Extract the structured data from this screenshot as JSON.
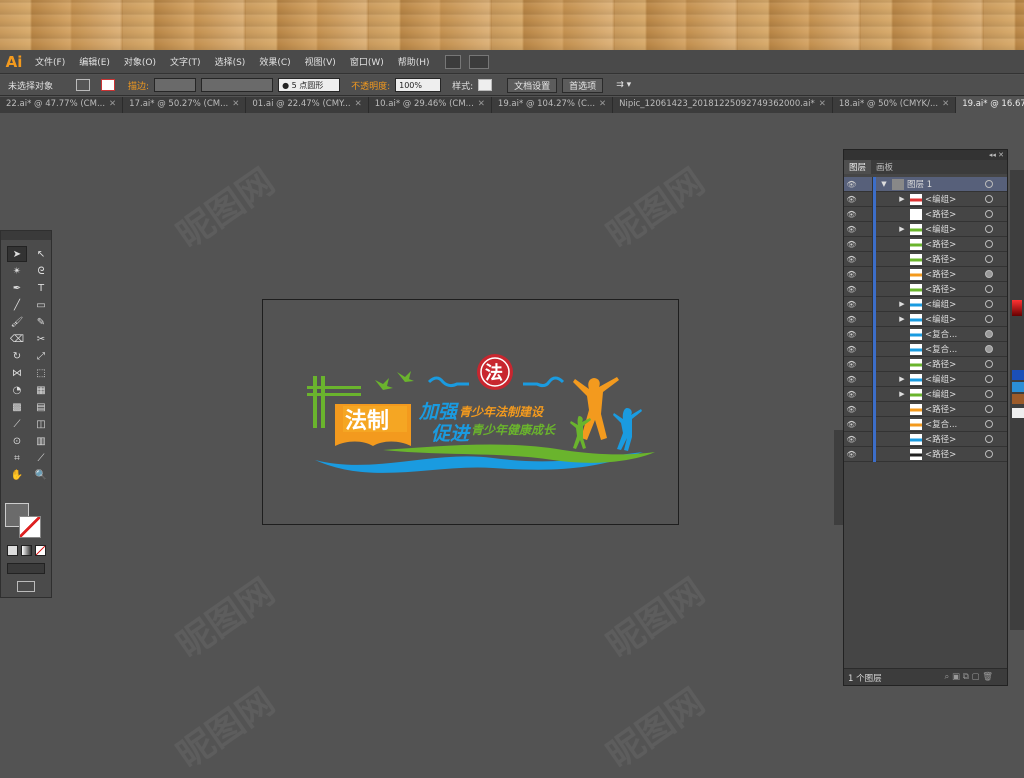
{
  "app_logo": "Ai",
  "menu": [
    "文件(F)",
    "编辑(E)",
    "对象(O)",
    "文字(T)",
    "选择(S)",
    "效果(C)",
    "视图(V)",
    "窗口(W)",
    "帮助(H)"
  ],
  "control": {
    "selection": "未选择对象",
    "stroke_label": "描边:",
    "brush": "● 5 点圆形",
    "opacity_label": "不透明度:",
    "opacity_value": "100%",
    "style_label": "样式:",
    "doc_setup": "文档设置",
    "prefs": "首选项"
  },
  "tabs": [
    {
      "label": "22.ai* @ 47.77% (CM...",
      "active": false
    },
    {
      "label": "17.ai* @ 50.27% (CM...",
      "active": false
    },
    {
      "label": "01.ai @ 22.47% (CMY...",
      "active": false
    },
    {
      "label": "10.ai* @ 29.46% (CM...",
      "active": false
    },
    {
      "label": "19.ai* @ 104.27% (C...",
      "active": false
    },
    {
      "label": "Nipic_12061423_20181225092749362000.ai*",
      "active": false
    },
    {
      "label": "18.ai* @ 50% (CMYK/...",
      "active": false
    },
    {
      "label": "19.ai* @ 16.67% (CMY",
      "active": true
    }
  ],
  "artwork": {
    "badge_char": "法",
    "book_text": "法制",
    "line1_big": "加强",
    "line1_small": "青少年法制建设",
    "line2_big": "促进",
    "line2_small": "青少年健康成长"
  },
  "layers_panel": {
    "tabs": [
      "图层",
      "画板"
    ],
    "top_layer": "图层 1",
    "rows": [
      {
        "label": "<编组>",
        "arrow": true,
        "circle_filled": false
      },
      {
        "label": "<路径>",
        "arrow": false,
        "circle_filled": false
      },
      {
        "label": "<编组>",
        "arrow": true,
        "circle_filled": false
      },
      {
        "label": "<路径>",
        "arrow": false,
        "circle_filled": false
      },
      {
        "label": "<路径>",
        "arrow": false,
        "circle_filled": false
      },
      {
        "label": "<路径>",
        "arrow": false,
        "circle_filled": true
      },
      {
        "label": "<路径>",
        "arrow": false,
        "circle_filled": false
      },
      {
        "label": "<编组>",
        "arrow": true,
        "circle_filled": false
      },
      {
        "label": "<编组>",
        "arrow": true,
        "circle_filled": false
      },
      {
        "label": "<复合...",
        "arrow": false,
        "circle_filled": true
      },
      {
        "label": "<复合...",
        "arrow": false,
        "circle_filled": true
      },
      {
        "label": "<路径>",
        "arrow": false,
        "circle_filled": false
      },
      {
        "label": "<编组>",
        "arrow": true,
        "circle_filled": false
      },
      {
        "label": "<编组>",
        "arrow": true,
        "circle_filled": false
      },
      {
        "label": "<路径>",
        "arrow": false,
        "circle_filled": false
      },
      {
        "label": "<复合...",
        "arrow": false,
        "circle_filled": false
      },
      {
        "label": "<路径>",
        "arrow": false,
        "circle_filled": false
      },
      {
        "label": "<路径>",
        "arrow": false,
        "circle_filled": false
      }
    ],
    "footer": "1 个图层"
  },
  "watermark": "昵图网",
  "colors": {
    "accent": "#f39a1e",
    "green": "#6ab42d",
    "blue": "#1a9be0",
    "red": "#c8262f"
  }
}
